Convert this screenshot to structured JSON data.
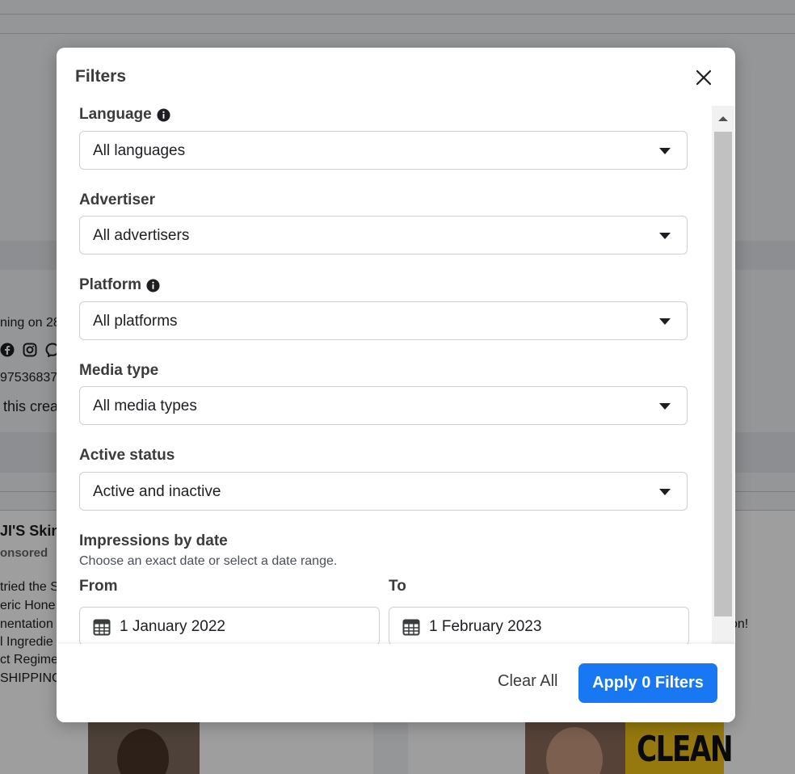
{
  "background": {
    "fragments": {
      "running_on": "ning on 28",
      "library_id": "97536837",
      "creative": "this crea",
      "advertiser_name": "JI'S Skin",
      "sponsored": "onsored",
      "body_lines": [
        "tried the S",
        "eric Hone",
        "nentation",
        "l Ingredie",
        "ct Regime",
        "SHIPPING"
      ],
      "right_fragment": "on!",
      "thumb_text": "CLEAN"
    }
  },
  "modal": {
    "title": "Filters",
    "close_icon": "close-icon",
    "fields": [
      {
        "label": "Language",
        "value": "All languages",
        "has_info": true
      },
      {
        "label": "Advertiser",
        "value": "All advertisers",
        "has_info": false
      },
      {
        "label": "Platform",
        "value": "All platforms",
        "has_info": true
      },
      {
        "label": "Media type",
        "value": "All media types",
        "has_info": false
      },
      {
        "label": "Active status",
        "value": "Active and inactive",
        "has_info": false
      }
    ],
    "impressions": {
      "label": "Impressions by date",
      "hint": "Choose an exact date or select a date range.",
      "from_label": "From",
      "to_label": "To",
      "from_value": "1 January 2022",
      "to_value": "1 February 2023"
    },
    "footer": {
      "clear_label": "Clear All",
      "apply_label": "Apply 0 Filters",
      "apply_color": "#1877f2"
    }
  }
}
